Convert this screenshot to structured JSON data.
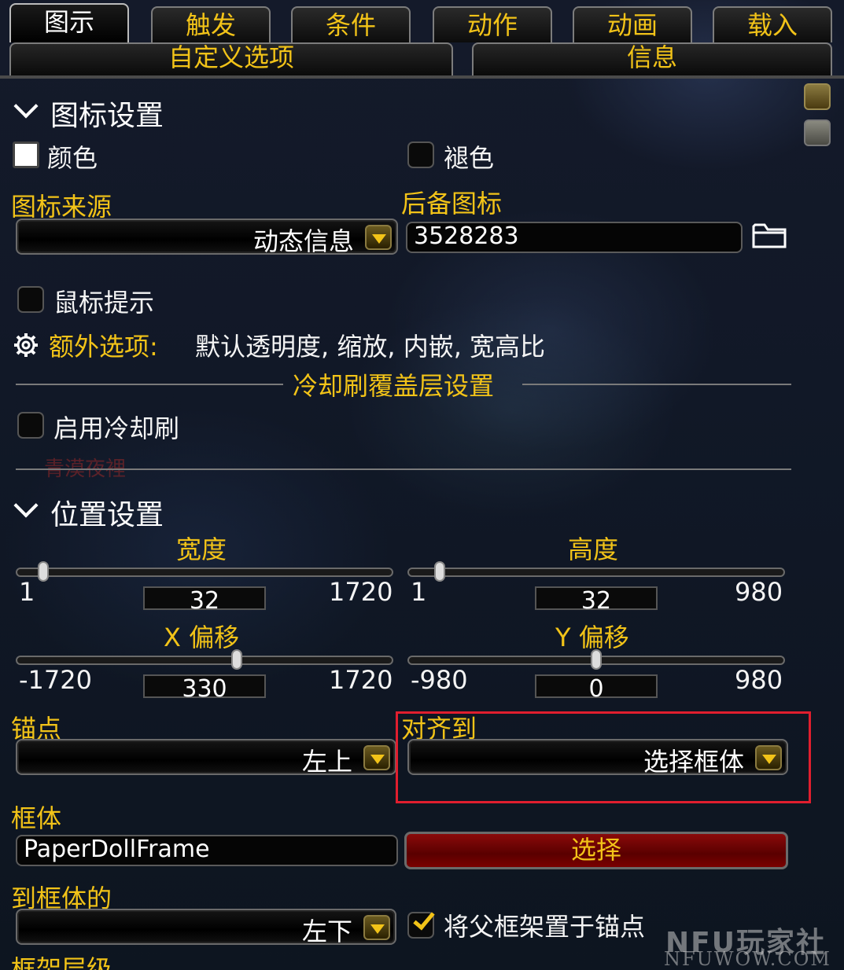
{
  "tabs_row1": [
    "图示",
    "触发",
    "条件",
    "动作",
    "动画",
    "载入"
  ],
  "tabs_row2": [
    "自定义选项",
    "信息"
  ],
  "icon_section": {
    "title": "图标设置",
    "color_label": "颜色",
    "desaturate_label": "褪色",
    "icon_source_label": "图标来源",
    "icon_source_value": "动态信息",
    "fallback_label": "后备图标",
    "fallback_value": "3528283",
    "tooltip_label": "鼠标提示",
    "extra_label": "额外选项:",
    "extra_value": "默认透明度, 缩放, 内嵌, 宽高比"
  },
  "cooldown_section": {
    "title": "冷却刷覆盖层设置",
    "enable_label": "启用冷却刷",
    "faded_text": "青漠夜裡"
  },
  "position_section": {
    "title": "位置设置",
    "width": {
      "label": "宽度",
      "min": "1",
      "value": "32",
      "max": "1720",
      "level": 0.018
    },
    "height": {
      "label": "高度",
      "min": "1",
      "value": "32",
      "max": "980",
      "level": 0.032
    },
    "xoffset": {
      "label": "X 偏移",
      "min": "-1720",
      "value": "330",
      "max": "1720",
      "level": 0.596
    },
    "yoffset": {
      "label": "Y 偏移",
      "min": "-980",
      "value": "0",
      "max": "980",
      "level": 0.5
    },
    "anchor_label": "锚点",
    "anchor_value": "左上",
    "align_label": "对齐到",
    "align_value": "选择框体",
    "frame_label": "框体",
    "frame_value": "PaperDollFrame",
    "select_label": "选择",
    "to_frame_label": "到框体的",
    "to_frame_value": "左下",
    "parent_label": "将父框架置于锚点",
    "strata_label": "框架层级"
  },
  "watermark": {
    "logo": "NFU玩家社区",
    "url": "NFUWOW.COM"
  },
  "colors": {
    "gold": "#f2c318",
    "highlight": "#e01e2e",
    "select_button": "#8a0a0a"
  }
}
